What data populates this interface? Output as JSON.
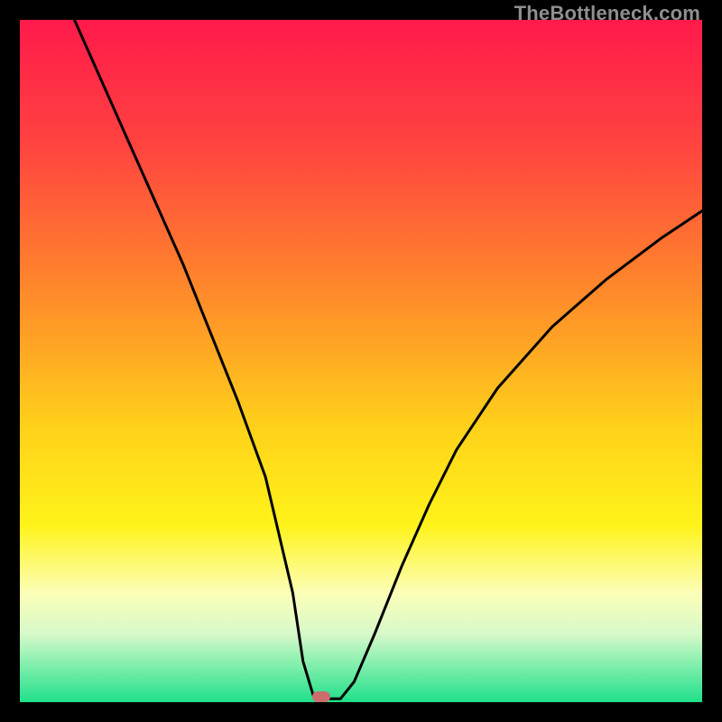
{
  "watermark": "TheBottleneck.com",
  "chart_data": {
    "type": "line",
    "title": "",
    "xlabel": "",
    "ylabel": "",
    "xlim": [
      0,
      100
    ],
    "ylim": [
      0,
      100
    ],
    "series": [
      {
        "name": "curve",
        "x": [
          8,
          12,
          16,
          20,
          24,
          28,
          32,
          36,
          40,
          41.5,
          43,
          45,
          47,
          49,
          52,
          56,
          60,
          64,
          70,
          78,
          86,
          94,
          100
        ],
        "y": [
          100,
          91,
          82,
          73,
          64,
          54,
          44,
          33,
          16,
          6,
          1,
          0.5,
          0.5,
          3,
          10,
          20,
          29,
          37,
          46,
          55,
          62,
          68,
          72
        ]
      }
    ],
    "marker": {
      "x": 44.2,
      "y": 0.8,
      "color": "#cc6d6d"
    },
    "gradient_stops": [
      {
        "pct": 0,
        "color": "#ff1a4b"
      },
      {
        "pct": 18,
        "color": "#ff4240"
      },
      {
        "pct": 40,
        "color": "#ff8a2a"
      },
      {
        "pct": 60,
        "color": "#ffd21a"
      },
      {
        "pct": 74,
        "color": "#fff31a"
      },
      {
        "pct": 84,
        "color": "#fcffb8"
      },
      {
        "pct": 90,
        "color": "#d7f9c9"
      },
      {
        "pct": 94,
        "color": "#8cf0b0"
      },
      {
        "pct": 100,
        "color": "#1fe08a"
      }
    ]
  }
}
